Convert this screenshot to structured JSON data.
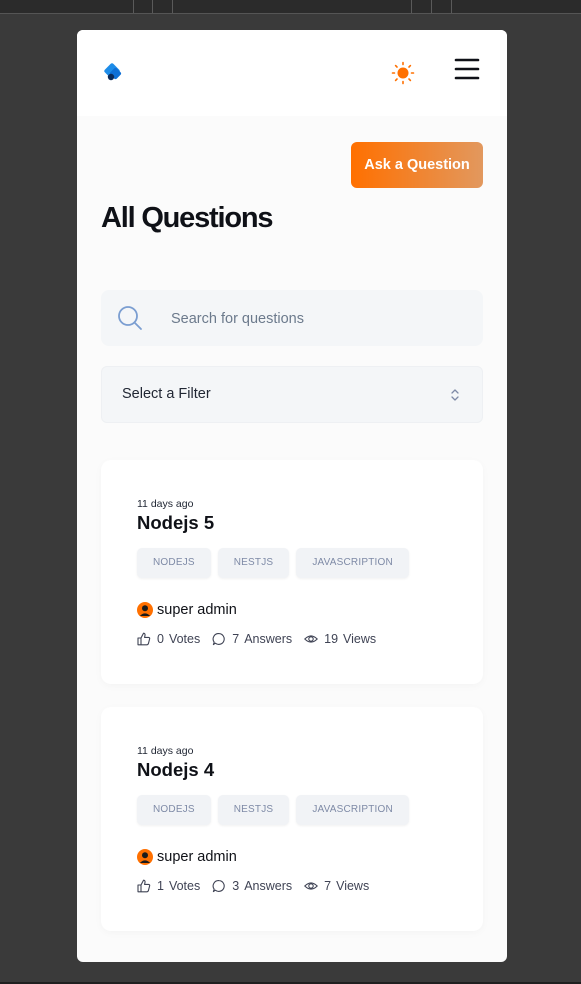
{
  "header": {
    "logo_icon": "devflow-logo-icon",
    "theme_icon": "sun-icon",
    "menu_icon": "hamburger-menu-icon",
    "accent_color": "#ff7000"
  },
  "page": {
    "ask_button_label": "Ask a Question",
    "title": "All Questions"
  },
  "search": {
    "placeholder": "Search for questions",
    "icon": "search-icon"
  },
  "filter": {
    "selected_label": "Select a Filter",
    "icon": "chevron-up-down-icon"
  },
  "questions": [
    {
      "time": "11 days ago",
      "title": "Nodejs 5",
      "tags": [
        "NODEJS",
        "NESTJS",
        "JAVASCRIPTION"
      ],
      "author": "super admin",
      "votes_count": "0",
      "votes_label": "Votes",
      "answers_count": "7",
      "answers_label": "Answers",
      "views_count": "19",
      "views_label": "Views"
    },
    {
      "time": "11 days ago",
      "title": "Nodejs 4",
      "tags": [
        "NODEJS",
        "NESTJS",
        "JAVASCRIPTION"
      ],
      "author": "super admin",
      "votes_count": "1",
      "votes_label": "Votes",
      "answers_count": "3",
      "answers_label": "Answers",
      "views_count": "7",
      "views_label": "Views"
    }
  ]
}
